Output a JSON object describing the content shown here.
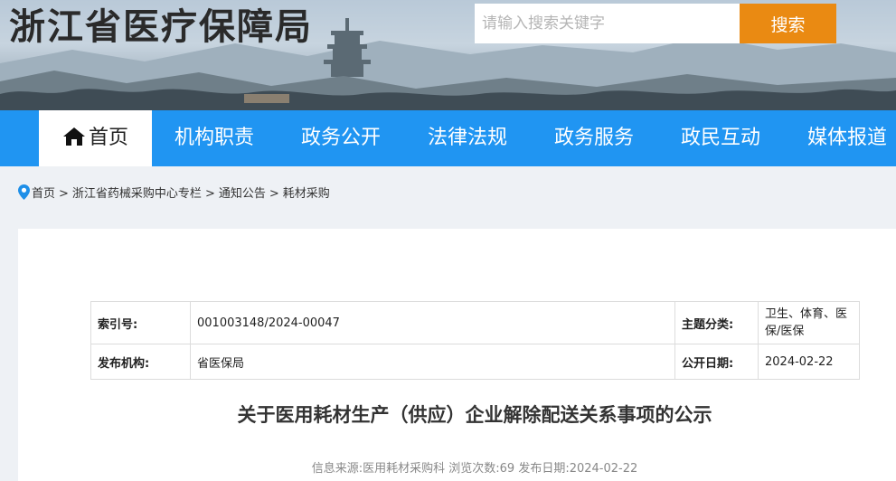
{
  "header": {
    "site_title": "浙江省医疗保障局",
    "search_placeholder": "请输入搜索关键字",
    "search_button": "搜索"
  },
  "nav": {
    "items": [
      {
        "label": "首页",
        "icon": "home-icon"
      },
      {
        "label": "机构职责"
      },
      {
        "label": "政务公开"
      },
      {
        "label": "法律法规"
      },
      {
        "label": "政务服务"
      },
      {
        "label": "政民互动"
      },
      {
        "label": "媒体报道"
      }
    ],
    "active_index": 0
  },
  "breadcrumb": {
    "icon": "location-pin-icon",
    "items": [
      "首页",
      "浙江省药械采购中心专栏",
      "通知公告",
      "耗材采购"
    ],
    "separator": ">"
  },
  "meta": {
    "index_label": "索引号:",
    "index_value": "001003148/2024-00047",
    "topic_label": "主题分类:",
    "topic_value": "卫生、体育、医保/医保",
    "publisher_label": "发布机构:",
    "publisher_value": "省医保局",
    "open_date_label": "公开日期:",
    "open_date_value": "2024-02-22"
  },
  "article": {
    "title": "关于医用耗材生产（供应）企业解除配送关系事项的公示",
    "source_label": "信息来源:",
    "source_value": "医用耗材采购科",
    "views_label": "浏览次数:",
    "views_value": "69",
    "date_label": "发布日期:",
    "date_value": "2024-02-22"
  },
  "colors": {
    "nav_blue": "#2095f2",
    "search_orange": "#ea8a12"
  }
}
